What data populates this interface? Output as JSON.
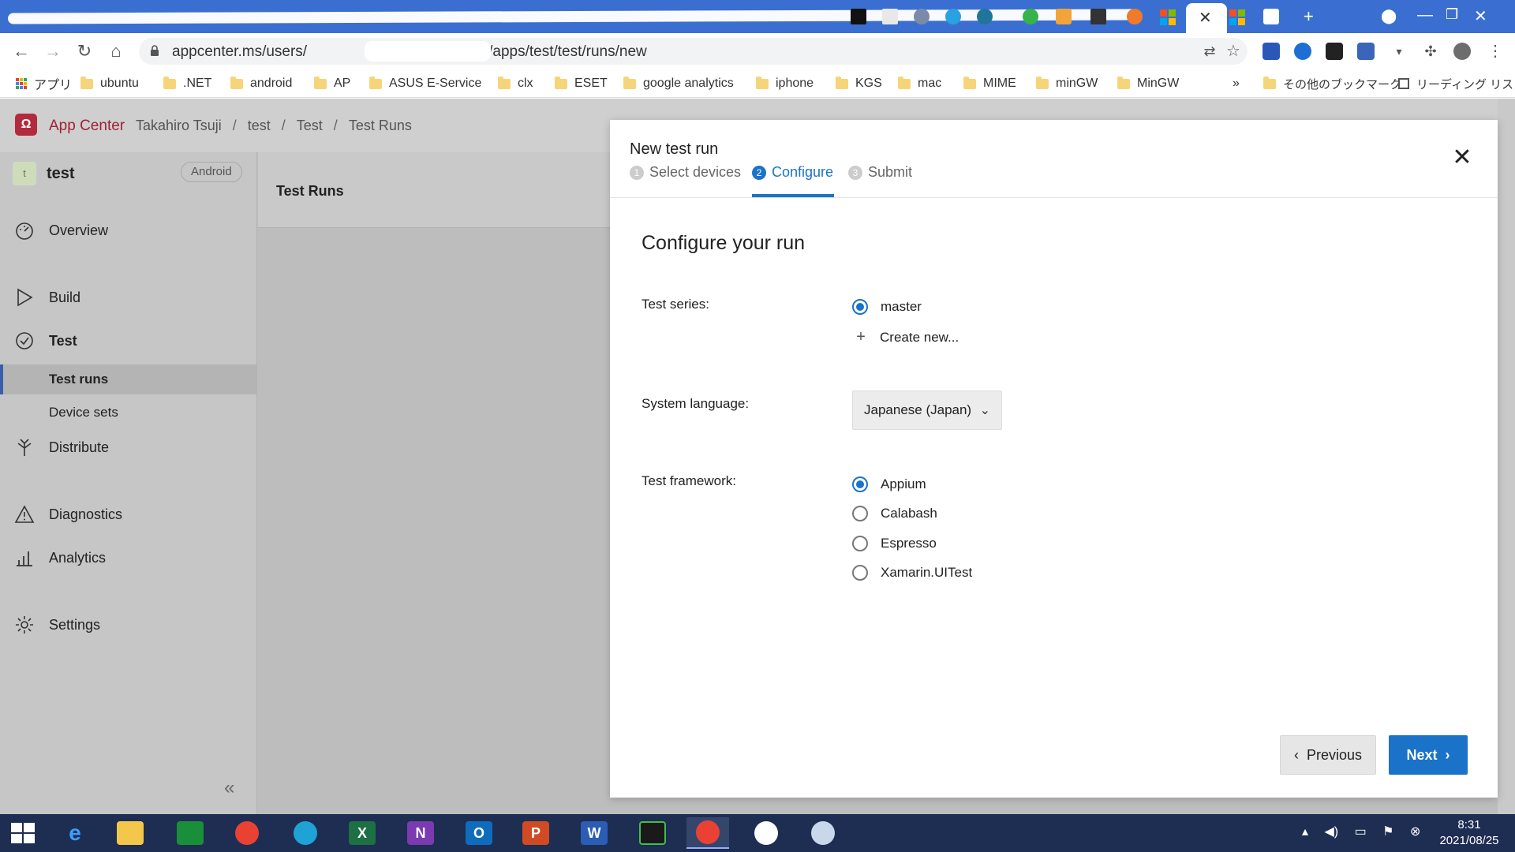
{
  "browser": {
    "url_visible_start": "appcenter.ms/users/",
    "url_visible_end": "/apps/test/test/runs/new",
    "bookmarks": [
      "アプリ",
      "ubuntu",
      ".NET",
      "android",
      "AP",
      "ASUS E-Service",
      "clx",
      "ESET",
      "google analytics",
      "iphone",
      "KGS",
      "mac",
      "MIME",
      "minGW",
      "MinGW"
    ],
    "bookmarks_overflow": "»",
    "other_bookmarks": "その他のブックマーク",
    "reading_list": "リーディング リスト"
  },
  "app": {
    "brand": "App Center",
    "breadcrumbs": [
      "Takahiro Tsuji",
      "test",
      "Test",
      "Test Runs"
    ],
    "app_avatar_letter": "t",
    "app_name": "test",
    "platform": "Android"
  },
  "sidebar": {
    "items": [
      {
        "label": "Overview",
        "icon": "dashboard-icon"
      },
      {
        "label": "Build",
        "icon": "play-icon"
      },
      {
        "label": "Test",
        "icon": "check-circle-icon"
      },
      {
        "label": "Distribute",
        "icon": "distribute-icon"
      },
      {
        "label": "Diagnostics",
        "icon": "warning-icon"
      },
      {
        "label": "Analytics",
        "icon": "bar-chart-icon"
      },
      {
        "label": "Settings",
        "icon": "gear-icon"
      }
    ],
    "test_sub": [
      "Test runs",
      "Device sets"
    ],
    "collapse_glyph": "«"
  },
  "content": {
    "title": "Test Runs"
  },
  "modal": {
    "title": "New test run",
    "steps": [
      {
        "num": "1",
        "label": "Select devices"
      },
      {
        "num": "2",
        "label": "Configure"
      },
      {
        "num": "3",
        "label": "Submit"
      }
    ],
    "active_step": 2,
    "section_title": "Configure your run",
    "test_series_label": "Test series:",
    "test_series_options": [
      "master"
    ],
    "create_new": "Create new...",
    "system_language_label": "System language:",
    "system_language_value": "Japanese (Japan)",
    "test_framework_label": "Test framework:",
    "frameworks": [
      "Appium",
      "Calabash",
      "Espresso",
      "Xamarin.UITest"
    ],
    "selected_framework": "Appium",
    "previous_label": "Previous",
    "next_label": "Next"
  },
  "taskbar": {
    "time": "8:31",
    "date": "2021/08/25"
  },
  "colors": {
    "accent": "#1a73c9",
    "brand": "#a02236",
    "taskbar": "#1e2d52",
    "tabstrip": "#3a6fd1"
  }
}
